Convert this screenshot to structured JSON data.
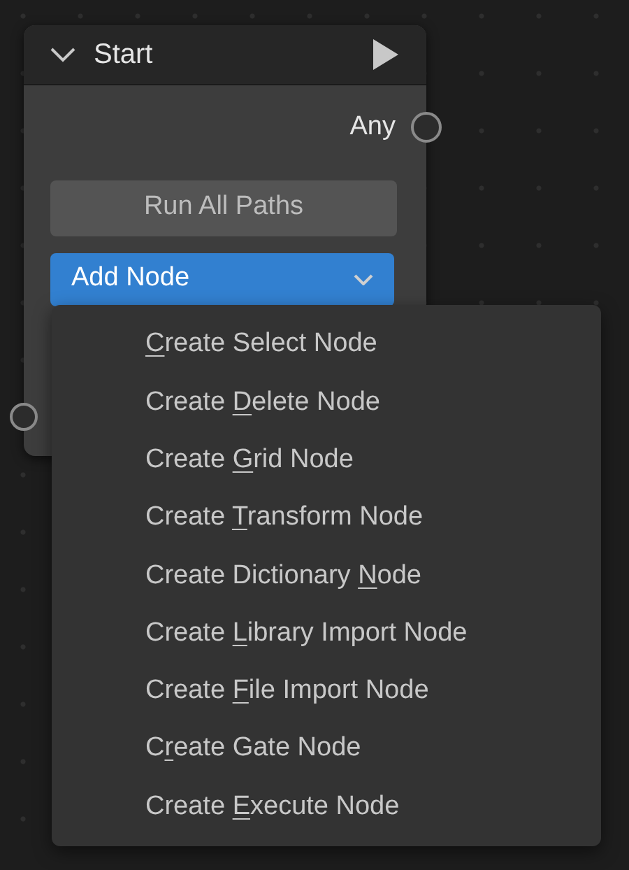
{
  "node": {
    "title": "Start",
    "expanded": true,
    "output_socket": {
      "label": "Any"
    },
    "run_button": {
      "label": "Run All Paths"
    },
    "dropdown": {
      "label": "Add Node",
      "open": true
    }
  },
  "menu": {
    "items": [
      {
        "key": "C",
        "after": "reate Select Node"
      },
      {
        "before": "Create ",
        "key": "D",
        "after": "elete Node"
      },
      {
        "before": "Create ",
        "key": "G",
        "after": "rid Node"
      },
      {
        "before": "Create ",
        "key": "T",
        "after": "ransform Node"
      },
      {
        "before": "Create Dictionary ",
        "key": "N",
        "after": "ode"
      },
      {
        "before": "Create ",
        "key": "L",
        "after": "ibrary Import Node"
      },
      {
        "before": "Create ",
        "key": "F",
        "after": "ile Import Node"
      },
      {
        "before": "C",
        "key": "r",
        "after": "eate Gate Node"
      },
      {
        "before": "Create ",
        "key": "E",
        "after": "xecute Node"
      }
    ]
  }
}
